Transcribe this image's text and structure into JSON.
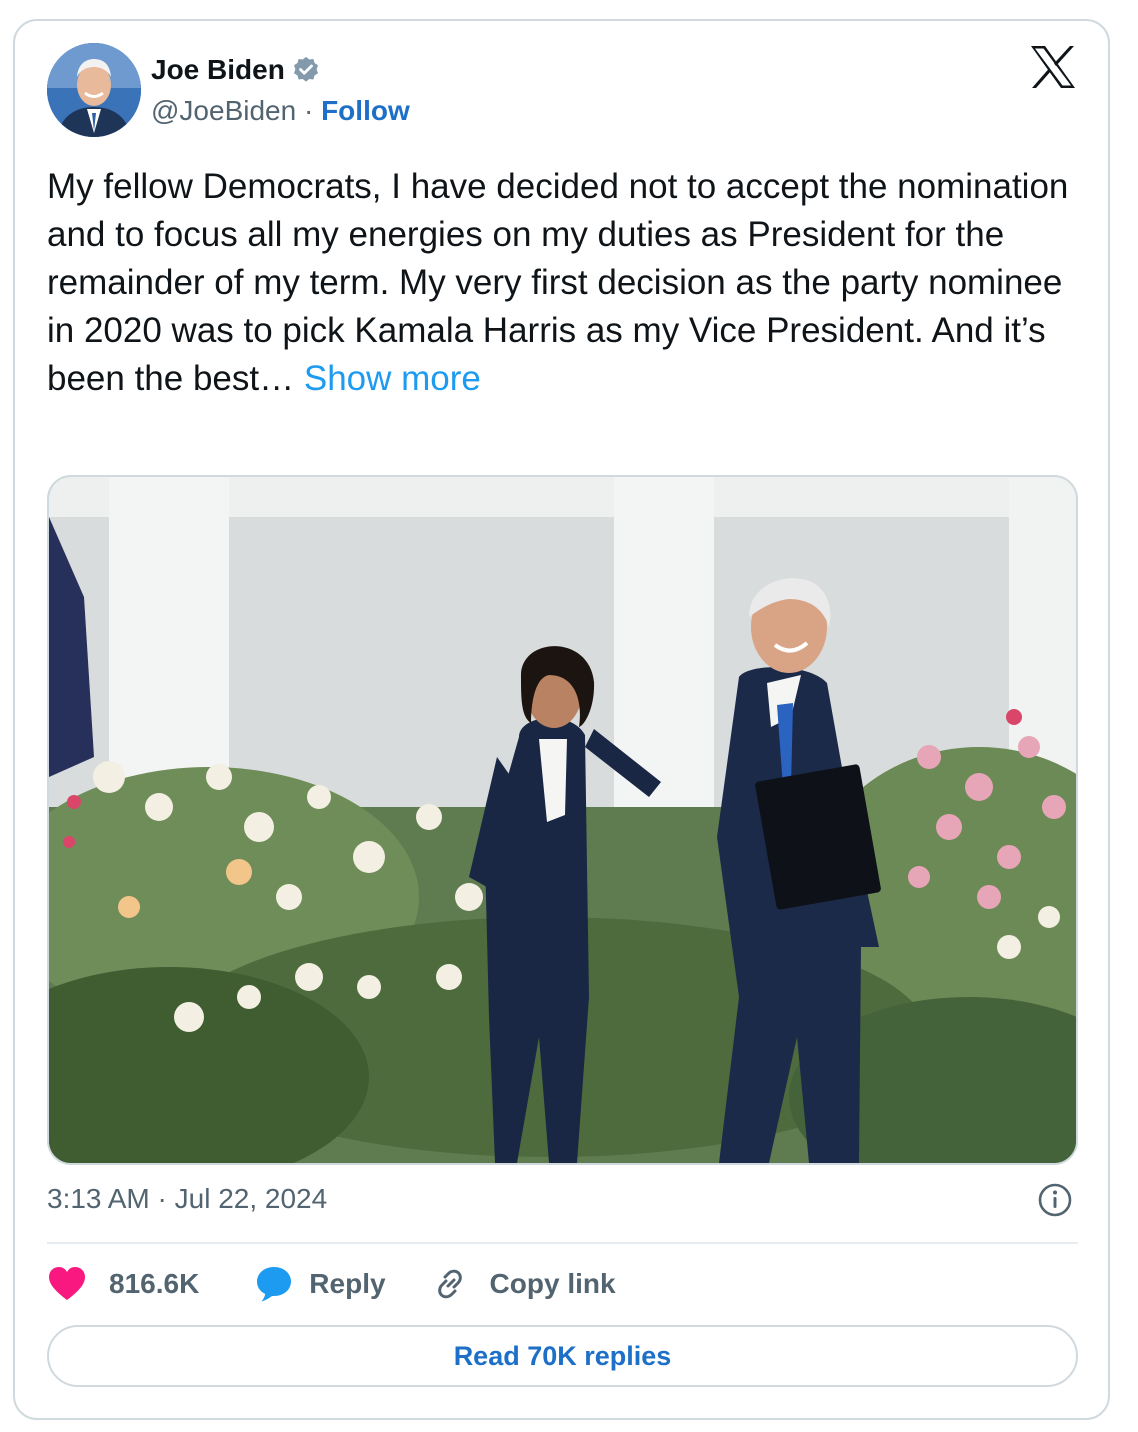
{
  "author": {
    "name": "Joe Biden",
    "handle": "@JoeBiden",
    "separator": " · ",
    "follow_label": "Follow",
    "verified": true
  },
  "tweet": {
    "text": "My fellow Democrats, I have decided not to accept the nomination and to focus all my energies on my duties as President for the remainder of my term. My very first decision as the party nominee in 2020 was to pick Kamala Harris as my Vice President. And it’s been the best… ",
    "show_more_label": "Show more",
    "time": "3:13 AM",
    "date": "Jul 22, 2024",
    "meta_separator": " · "
  },
  "actions": {
    "likes": "816.6K",
    "reply_label": "Reply",
    "copy_label": "Copy link",
    "read_replies_label": "Read 70K replies"
  },
  "colors": {
    "like": "#f91880",
    "reply_bubble": "#1d9bf0",
    "link": "#1d6fc7",
    "text_secondary": "#536471",
    "border": "#cfd9de"
  },
  "icons": {
    "logo": "x-logo-icon",
    "verified": "verified-badge-icon",
    "info": "info-icon",
    "like": "heart-icon",
    "reply": "speech-bubble-icon",
    "copy": "link-icon"
  }
}
